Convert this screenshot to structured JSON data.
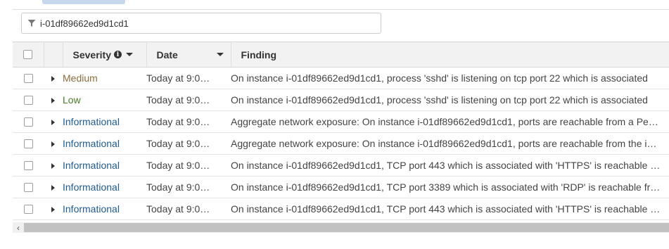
{
  "filter": {
    "value": "i-01df89662ed9d1cd1",
    "icon": "filter-icon"
  },
  "table": {
    "headers": {
      "severity": "Severity",
      "date": "Date",
      "finding": "Finding"
    },
    "rows": [
      {
        "severity": "Medium",
        "severity_level": "medium",
        "date": "Today at 9:0…",
        "finding": "On instance i-01df89662ed9d1cd1, process 'sshd' is listening on tcp port 22 which is associated"
      },
      {
        "severity": "Low",
        "severity_level": "low",
        "date": "Today at 9:0…",
        "finding": "On instance i-01df89662ed9d1cd1, process 'sshd' is listening on tcp port 22 which is associated"
      },
      {
        "severity": "Informational",
        "severity_level": "info",
        "date": "Today at 9:0…",
        "finding": "Aggregate network exposure: On instance i-01df89662ed9d1cd1, ports are reachable from a Pe…"
      },
      {
        "severity": "Informational",
        "severity_level": "info",
        "date": "Today at 9:0…",
        "finding": "Aggregate network exposure: On instance i-01df89662ed9d1cd1, ports are reachable from the i…"
      },
      {
        "severity": "Informational",
        "severity_level": "info",
        "date": "Today at 9:0…",
        "finding": "On instance i-01df89662ed9d1cd1, TCP port 443 which is associated with 'HTTPS' is reachable …"
      },
      {
        "severity": "Informational",
        "severity_level": "info",
        "date": "Today at 9:0…",
        "finding": "On instance i-01df89662ed9d1cd1, TCP port 3389 which is associated with 'RDP' is reachable fr…"
      },
      {
        "severity": "Informational",
        "severity_level": "info",
        "date": "Today at 9:0…",
        "finding": "On instance i-01df89662ed9d1cd1, TCP port 443 which is associated with 'HTTPS' is reachable …"
      }
    ]
  },
  "colors": {
    "medium": "#8a6d3b",
    "low": "#4a7c2a",
    "info": "#1e5b8f"
  }
}
